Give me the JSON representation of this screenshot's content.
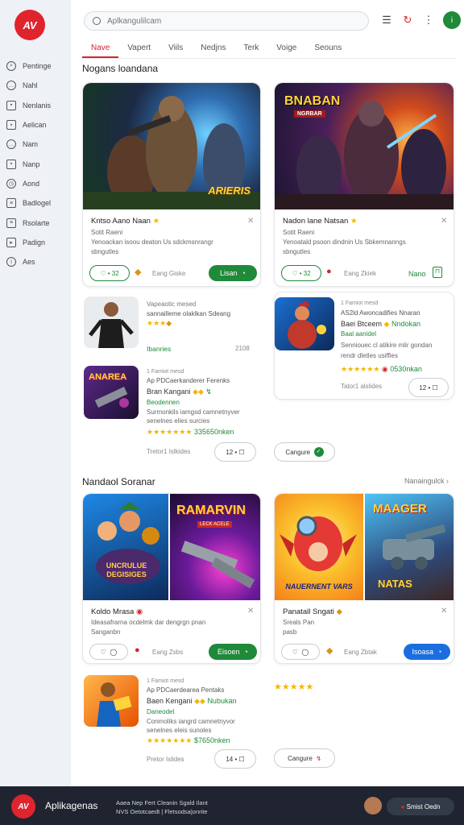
{
  "app": {
    "logo": "AV",
    "name": "Aplikagenas"
  },
  "header": {
    "search_placeholder": "Aplkangulilcam",
    "avatar": "i",
    "icons": [
      "menu-icon",
      "notification-icon",
      "more-icon"
    ]
  },
  "sidebar": {
    "items": [
      "Pentinge",
      "Nahl",
      "Nenlanis",
      "Aelican",
      "Nam",
      "Nanp",
      "Aond",
      "Badlogel",
      "Rsolarte",
      "Padign",
      "Aes"
    ]
  },
  "tabs": {
    "items": [
      "Nave",
      "Vapert",
      "Viils",
      "Nedjns",
      "Terk",
      "Voige",
      "Seouns"
    ],
    "active": "Nave"
  },
  "section1": {
    "title": "Nogans loandana"
  },
  "card1": {
    "banner": "ARIERIS",
    "title": "Kntso Aano Naan",
    "desc1": "Sotit Raeni",
    "desc2": "Yenoackan isoou deaton Us sdckmsnrangr",
    "desc3": "sbngutles",
    "pill": "32",
    "meta": "Eang Giske",
    "button": "Lisan"
  },
  "card2": {
    "banner": "BNABAN",
    "banner_sub": "NGRBAR",
    "title": "Nadon lane Natsan",
    "desc1": "Sotit Raeni",
    "desc2": "Yenoatald psoon dindnin Us Sbkemnanngs",
    "desc3": "sbngutles",
    "pill": "32",
    "meta": "Eang Zkiek",
    "button": "Nano"
  },
  "list1": {
    "line1": "Vapeaotic mesed",
    "line2": "sannailleme olaklkan Sdeang",
    "green": "Ibanries",
    "meta": "2108"
  },
  "list2": {
    "thumb": "ANAREA",
    "line1": "1 Famiot mesd",
    "line2": "Ap PDCaerkanderer Ferenks",
    "title": "Bran Kangani",
    "sub": "Beodennen",
    "desc1": "Surmonkils iamgsd camnetnyver",
    "desc3": "senelnes elies surcies",
    "green": "335650nken",
    "foot": "Tretor1 Islkides",
    "pill": "12"
  },
  "list3": {
    "line1": "1 Famiot mesd",
    "line2": "AS2ld Awoncadifies Nnaran",
    "title": "Baei Btceem",
    "green_right": "Nndokan",
    "sub": "Baal aanidel",
    "desc1": "Senniouec cl atikire mlir gondan",
    "desc2": "rendr dletles usiffies",
    "green": "0530nkan",
    "foot": "Tator1 alslides",
    "pill": "12"
  },
  "continue1": {
    "label": "Cangure"
  },
  "section2": {
    "title": "Nandaol Soranar",
    "link": "Nanaingulck"
  },
  "card3": {
    "thumb1": "UNCRULUE DEGISIGES",
    "thumb2": "RAMARVIN",
    "thumb2_sub": "LECK ACELE",
    "title": "Koldo Mrasa",
    "desc1": "Ideasafrarna ocdelmk dar dengrgn pnan",
    "desc2": "Sanganbn",
    "meta": "Eang Zsbs",
    "button": "Eisoen"
  },
  "card4": {
    "thumb1": "NAUERNENT VARS",
    "thumb2": "MAAGER",
    "thumb2_sub": "NATAS",
    "title": "Panatall Sngati",
    "desc1": "Sreals Pan",
    "desc2": "pasb",
    "meta": "Eang Zbtak",
    "button": "Isoasa"
  },
  "list4": {
    "line1": "1 Famiot mesd",
    "line2": "Ap PDCaerdearea Pentaks",
    "title": "Baen Kengani",
    "green_right": "Nubukan",
    "sub": "Daneodel",
    "desc1": "Conmoliks iangrd camnetnyvor",
    "desc3": "senelnes eleis sunoles",
    "green": "$7650nken",
    "foot": "Pretor Islides",
    "pill": "14"
  },
  "continue2": {
    "label": "Cangure"
  },
  "footer": {
    "line1": "Aaea Nep Fert Cleanin Sgald Ilant",
    "line2": "NVS Oetotcaedt | Fletsodsa|onrite",
    "button": "Smist Oedn"
  },
  "colors": {
    "accent": "#d6262f",
    "green": "#1f8a3a",
    "blue": "#1a6ee0"
  }
}
